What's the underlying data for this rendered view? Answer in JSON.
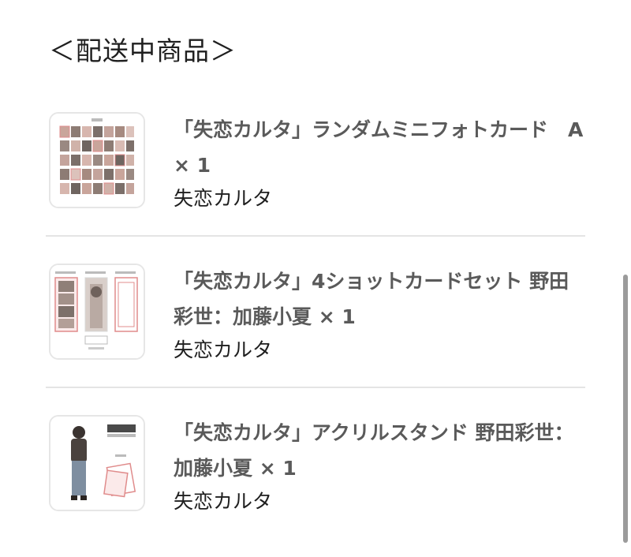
{
  "section": {
    "title": "＜配送中商品＞"
  },
  "items": [
    {
      "name": "「失恋カルタ」ランダムミニフォトカード　A × 1",
      "artist": "失恋カルタ",
      "thumbnail": "photo-card-grid-icon"
    },
    {
      "name": "「失恋カルタ」4ショットカードセット 野田彩世：加藤小夏 × 1",
      "artist": "失恋カルタ",
      "thumbnail": "four-shot-card-set-icon"
    },
    {
      "name": "「失恋カルタ」アクリルスタンド 野田彩世：加藤小夏 × 1",
      "artist": "失恋カルタ",
      "thumbnail": "acrylic-stand-icon"
    }
  ],
  "colors": {
    "divider": "#e4e4e4",
    "item_name": "#5a5a5a",
    "text": "#1f1f1f",
    "scrollbar": "#9b9b9b"
  }
}
